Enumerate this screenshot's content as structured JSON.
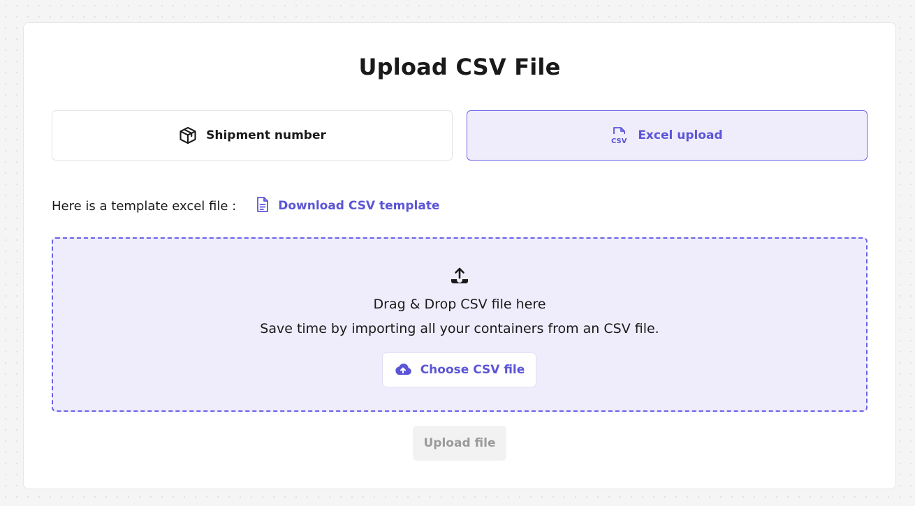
{
  "page": {
    "title": "Upload CSV File"
  },
  "tabs": {
    "shipment_label": "Shipment number",
    "shipment_icon": "package-icon",
    "excel_label": "Excel upload",
    "excel_icon": "csv-file-icon",
    "active_tab": "Excel upload"
  },
  "template": {
    "label": "Here is a template excel file :",
    "link_label": "Download CSV template",
    "link_icon": "document-icon"
  },
  "dropzone": {
    "icon": "upload-tray-icon",
    "title": "Drag & Drop CSV file here",
    "subtitle": "Save time by importing all your containers from an CSV file.",
    "choose_button_label": "Choose CSV file",
    "choose_button_icon": "cloud-upload-icon"
  },
  "actions": {
    "upload_label": "Upload file",
    "upload_disabled": true
  },
  "colors": {
    "accent": "#5b55d6",
    "accent_border": "#6a63e6",
    "accent_bg": "#efedfc",
    "disabled_text": "#9a9a9a",
    "disabled_bg": "#f2f2f2"
  }
}
